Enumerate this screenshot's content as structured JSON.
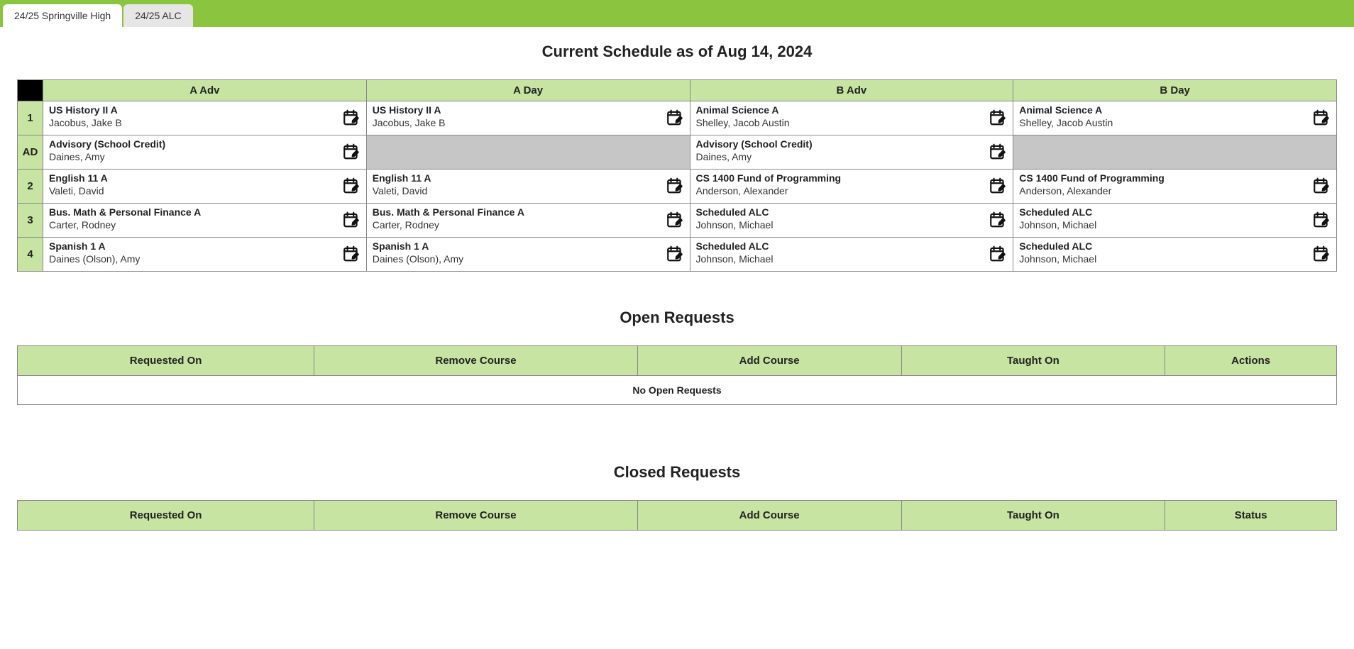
{
  "tabs": [
    {
      "label": "24/25 Springville High",
      "active": true
    },
    {
      "label": "24/25 ALC",
      "active": false
    }
  ],
  "schedule_title": "Current Schedule as of Aug 14, 2024",
  "schedule": {
    "columns": [
      "A Adv",
      "A Day",
      "B Adv",
      "B Day"
    ],
    "rows": [
      {
        "label": "1",
        "cells": [
          {
            "course": "US History II A",
            "teacher": "Jacobus, Jake B"
          },
          {
            "course": "US History II A",
            "teacher": "Jacobus, Jake B"
          },
          {
            "course": "Animal Science A",
            "teacher": "Shelley, Jacob Austin"
          },
          {
            "course": "Animal Science A",
            "teacher": "Shelley, Jacob Austin"
          }
        ]
      },
      {
        "label": "AD",
        "cells": [
          {
            "course": "Advisory (School Credit)",
            "teacher": "Daines, Amy"
          },
          {
            "blank": true
          },
          {
            "course": "Advisory (School Credit)",
            "teacher": "Daines, Amy"
          },
          {
            "blank": true
          }
        ]
      },
      {
        "label": "2",
        "cells": [
          {
            "course": "English 11 A",
            "teacher": "Valeti, David"
          },
          {
            "course": "English 11 A",
            "teacher": "Valeti, David"
          },
          {
            "course": "CS 1400 Fund of Programming",
            "teacher": "Anderson, Alexander"
          },
          {
            "course": "CS 1400 Fund of Programming",
            "teacher": "Anderson, Alexander"
          }
        ]
      },
      {
        "label": "3",
        "cells": [
          {
            "course": "Bus. Math & Personal Finance A",
            "teacher": "Carter, Rodney"
          },
          {
            "course": "Bus. Math & Personal Finance A",
            "teacher": "Carter, Rodney"
          },
          {
            "course": "Scheduled ALC",
            "teacher": "Johnson, Michael"
          },
          {
            "course": "Scheduled ALC",
            "teacher": "Johnson, Michael"
          }
        ]
      },
      {
        "label": "4",
        "cells": [
          {
            "course": "Spanish 1 A",
            "teacher": "Daines (Olson), Amy"
          },
          {
            "course": "Spanish 1 A",
            "teacher": "Daines (Olson), Amy"
          },
          {
            "course": "Scheduled ALC",
            "teacher": "Johnson, Michael"
          },
          {
            "course": "Scheduled ALC",
            "teacher": "Johnson, Michael"
          }
        ]
      }
    ]
  },
  "open_requests": {
    "title": "Open Requests",
    "columns": [
      "Requested On",
      "Remove Course",
      "Add Course",
      "Taught On",
      "Actions"
    ],
    "empty_text": "No Open Requests"
  },
  "closed_requests": {
    "title": "Closed Requests",
    "columns": [
      "Requested On",
      "Remove Course",
      "Add Course",
      "Taught On",
      "Status"
    ]
  }
}
